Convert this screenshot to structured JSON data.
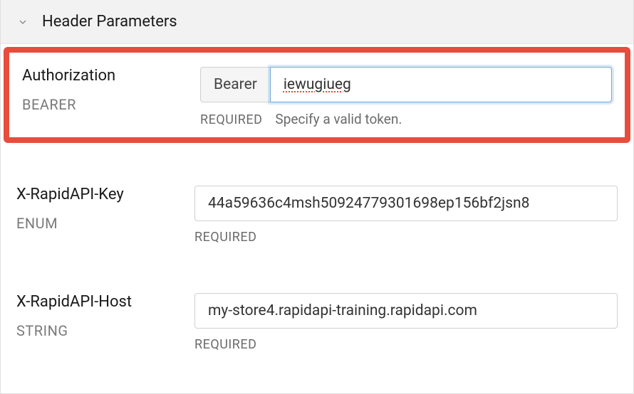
{
  "section": {
    "title": "Header Parameters"
  },
  "params": {
    "authorization": {
      "name": "Authorization",
      "type": "BEARER",
      "prefix": "Bearer",
      "value": "iewugiueg",
      "required_label": "REQUIRED",
      "helper": "Specify a valid token."
    },
    "rapidapi_key": {
      "name": "X-RapidAPI-Key",
      "type": "ENUM",
      "value": "44a59636c4msh50924779301698ep156bf2jsn8",
      "required_label": "REQUIRED"
    },
    "rapidapi_host": {
      "name": "X-RapidAPI-Host",
      "type": "STRING",
      "value": "my-store4.rapidapi-training.rapidapi.com",
      "required_label": "REQUIRED"
    }
  },
  "colors": {
    "highlight": "#e84c3d",
    "focus": "#6fa8dc"
  }
}
